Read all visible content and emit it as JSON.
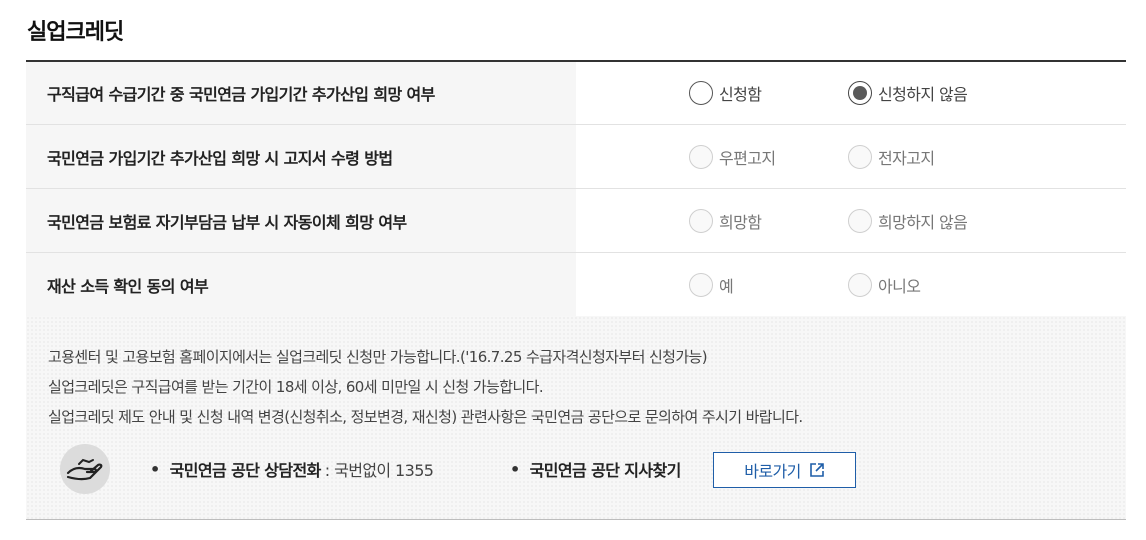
{
  "page": {
    "title": "실업크레딧"
  },
  "rows": [
    {
      "label": "구직급여 수급기간 중 국민연금 가입기간 추가산입 희망 여부",
      "options": [
        {
          "label": "신청함",
          "checked": false,
          "disabled": false
        },
        {
          "label": "신청하지 않음",
          "checked": true,
          "disabled": false
        }
      ]
    },
    {
      "label": "국민연금 가입기간 추가산입 희망 시 고지서 수령 방법",
      "options": [
        {
          "label": "우편고지",
          "checked": false,
          "disabled": true
        },
        {
          "label": "전자고지",
          "checked": false,
          "disabled": true
        }
      ]
    },
    {
      "label": "국민연금 보험료 자기부담금 납부 시 자동이체 희망 여부",
      "options": [
        {
          "label": "희망함",
          "checked": false,
          "disabled": true
        },
        {
          "label": "희망하지 않음",
          "checked": false,
          "disabled": true
        }
      ]
    },
    {
      "label": "재산 소득 확인 동의 여부",
      "options": [
        {
          "label": "예",
          "checked": false,
          "disabled": true
        },
        {
          "label": "아니오",
          "checked": false,
          "disabled": true
        }
      ]
    }
  ],
  "info": {
    "lines": [
      "고용센터 및 고용보험 홈페이지에서는 실업크레딧 신청만 가능합니다.('16.7.25 수급자격신청자부터 신청가능)",
      "실업크레딧은 구직급여를 받는 기간이 18세 이상, 60세 미만일 시 신청 가능합니다.",
      "실업크레딧 제도 안내 및 신청 내역 변경(신청취소, 정보변경, 재신청) 관련사항은 국민연금 공단으로 문의하여 주시기 바랍니다."
    ],
    "icon": "hand-support-icon",
    "contacts": [
      {
        "bullet": "•",
        "label": "국민연금 공단 상담전화",
        "value": ": 국번없이 1355"
      },
      {
        "bullet": "•",
        "label": "국민연금 공단 지사찾기",
        "value": ""
      }
    ],
    "goto_button": {
      "label": "바로가기",
      "icon": "external-link-icon",
      "color": "#1f5ea8"
    }
  }
}
